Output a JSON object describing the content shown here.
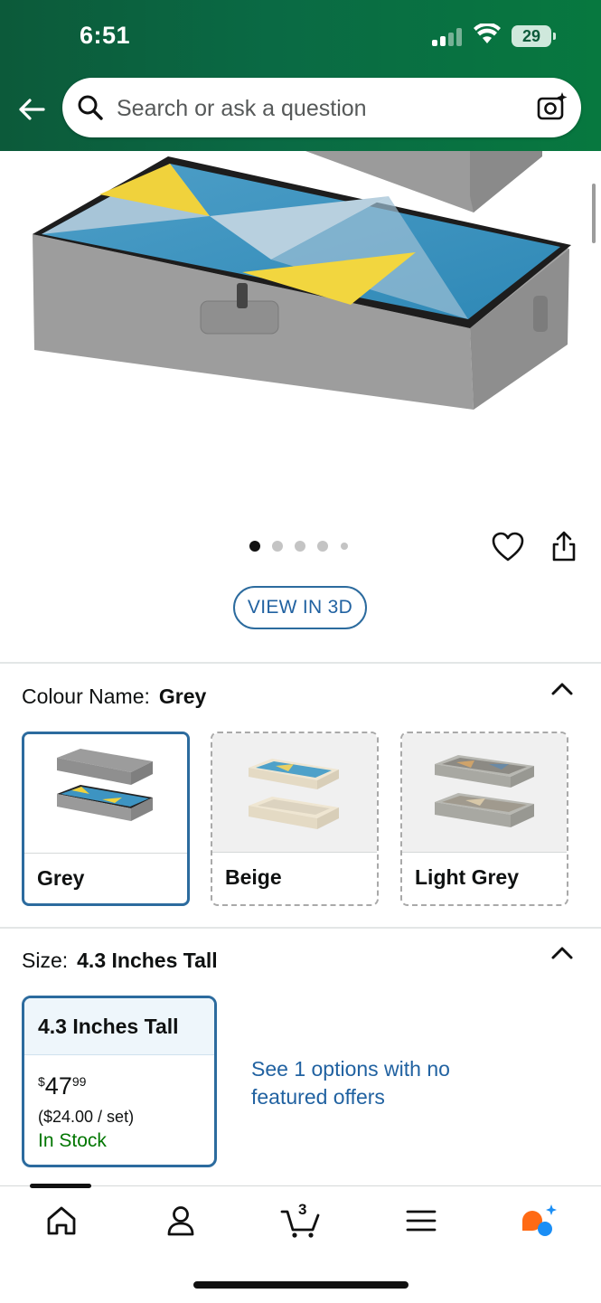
{
  "status_bar": {
    "time": "6:51",
    "battery": "29"
  },
  "search": {
    "placeholder": "Search or ask a question"
  },
  "gallery": {
    "image_count": 5,
    "active_index": 0,
    "view_3d_label": "VIEW IN 3D"
  },
  "colour": {
    "label": "Colour Name:",
    "selected": "Grey",
    "options": [
      {
        "name": "Grey",
        "selected": true
      },
      {
        "name": "Beige",
        "selected": false
      },
      {
        "name": "Light Grey",
        "selected": false
      }
    ]
  },
  "size": {
    "label": "Size:",
    "selected": "4.3 Inches Tall",
    "card": {
      "title": "4.3 Inches Tall",
      "currency": "$",
      "price_whole": "47",
      "price_fraction": "99",
      "unit_price": "($24.00 / set)",
      "availability": "In Stock"
    },
    "more_offers": "See 1 options with no featured offers"
  },
  "tabbar": {
    "items": [
      "home",
      "account",
      "cart",
      "menu",
      "rufus"
    ],
    "cart_count": "3"
  },
  "colors": {
    "header_green": "#0a6a44",
    "link_blue": "#2162a1",
    "selected_border": "#2c6b9e",
    "in_stock_green": "#007600"
  }
}
